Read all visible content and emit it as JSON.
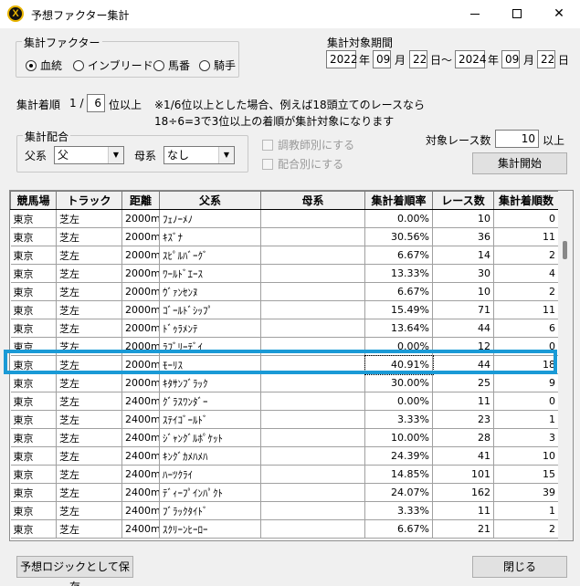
{
  "window": {
    "title": "予想ファクター集計",
    "app_icon": "X"
  },
  "factor_group": {
    "legend": "集計ファクター",
    "options": [
      {
        "label": "血統",
        "selected": true
      },
      {
        "label": "インブリード",
        "selected": false
      },
      {
        "label": "馬番",
        "selected": false
      },
      {
        "label": "騎手",
        "selected": false
      }
    ]
  },
  "period": {
    "label": "集計対象期間",
    "from_year": "2022",
    "from_month": "09",
    "from_day": "22",
    "to_year": "2024",
    "to_month": "09",
    "to_day": "22",
    "year_unit": "年",
    "month_unit": "月",
    "day_unit": "日",
    "range_sep": "日～"
  },
  "rank": {
    "label": "集計着順",
    "prefix": "1 /",
    "value": "6",
    "suffix": "位以上",
    "note_line1": "※1/6位以上とした場合、例えば18頭立てのレースなら",
    "note_line2": "18÷6=3で3位以上の着順が集計対象になります"
  },
  "pairing": {
    "legend": "集計配合",
    "sire_label": "父系",
    "sire_value": "父",
    "dam_label": "母系",
    "dam_value": "なし"
  },
  "checkboxes": {
    "by_trainer": "調教師別にする",
    "by_pairing": "配合別にする"
  },
  "race_count": {
    "label": "対象レース数",
    "value": "10",
    "suffix": "以上"
  },
  "buttons": {
    "start": "集計開始",
    "save": "予想ロジックとして保存",
    "close": "閉じる"
  },
  "table": {
    "columns": [
      "競馬場",
      "トラック",
      "距離",
      "父系",
      "母系",
      "集計着順率",
      "レース数",
      "集計着順数"
    ],
    "rows": [
      [
        "東京",
        "芝左",
        "2000m",
        "ﾌｪﾉｰﾒﾉ",
        "",
        "0.00%",
        "10",
        "0"
      ],
      [
        "東京",
        "芝左",
        "2000m",
        "ｷｽﾞﾅ",
        "",
        "30.56%",
        "36",
        "11"
      ],
      [
        "東京",
        "芝左",
        "2000m",
        "ｽﾋﾟﾙﾊﾞｰｸﾞ",
        "",
        "6.67%",
        "14",
        "2"
      ],
      [
        "東京",
        "芝左",
        "2000m",
        "ﾜｰﾙﾄﾞｴｰｽ",
        "",
        "13.33%",
        "30",
        "4"
      ],
      [
        "東京",
        "芝左",
        "2000m",
        "ｳﾞｧﾝｾﾝﾇ",
        "",
        "6.67%",
        "10",
        "2"
      ],
      [
        "東京",
        "芝左",
        "2000m",
        "ｺﾞｰﾙﾄﾞｼｯﾌﾟ",
        "",
        "15.49%",
        "71",
        "11"
      ],
      [
        "東京",
        "芝左",
        "2000m",
        "ﾄﾞｩﾗﾒﾝﾃ",
        "",
        "13.64%",
        "44",
        "6"
      ],
      [
        "東京",
        "芝左",
        "2000m",
        "ﾗﾌﾞﾘｰﾃﾞｲ",
        "",
        "0.00%",
        "12",
        "0"
      ],
      [
        "東京",
        "芝左",
        "2000m",
        "ﾓｰﾘｽ",
        "",
        "40.91%",
        "44",
        "18"
      ],
      [
        "東京",
        "芝左",
        "2000m",
        "ｷﾀｻﾝﾌﾞﾗｯｸ",
        "",
        "30.00%",
        "25",
        "9"
      ],
      [
        "東京",
        "芝左",
        "2400m",
        "ｸﾞﾗｽﾜﾝﾀﾞｰ",
        "",
        "0.00%",
        "11",
        "0"
      ],
      [
        "東京",
        "芝左",
        "2400m",
        "ｽﾃｲｺﾞｰﾙﾄﾞ",
        "",
        "3.33%",
        "23",
        "1"
      ],
      [
        "東京",
        "芝左",
        "2400m",
        "ｼﾞｬﾝｸﾞﾙﾎﾟｹｯﾄ",
        "",
        "10.00%",
        "28",
        "3"
      ],
      [
        "東京",
        "芝左",
        "2400m",
        "ｷﾝｸﾞｶﾒﾊﾒﾊ",
        "",
        "24.39%",
        "41",
        "10"
      ],
      [
        "東京",
        "芝左",
        "2400m",
        "ﾊｰﾂｸﾗｲ",
        "",
        "14.85%",
        "101",
        "15"
      ],
      [
        "東京",
        "芝左",
        "2400m",
        "ﾃﾞｨｰﾌﾟｲﾝﾊﾟｸﾄ",
        "",
        "24.07%",
        "162",
        "39"
      ],
      [
        "東京",
        "芝左",
        "2400m",
        "ﾌﾞﾗｯｸﾀｲﾄﾞ",
        "",
        "3.33%",
        "11",
        "1"
      ],
      [
        "東京",
        "芝左",
        "2400m",
        "ｽｸﾘｰﾝﾋｰﾛｰ",
        "",
        "6.67%",
        "21",
        "2"
      ]
    ],
    "highlighted_row": 8,
    "highlight_color": "#1a9ad6"
  }
}
